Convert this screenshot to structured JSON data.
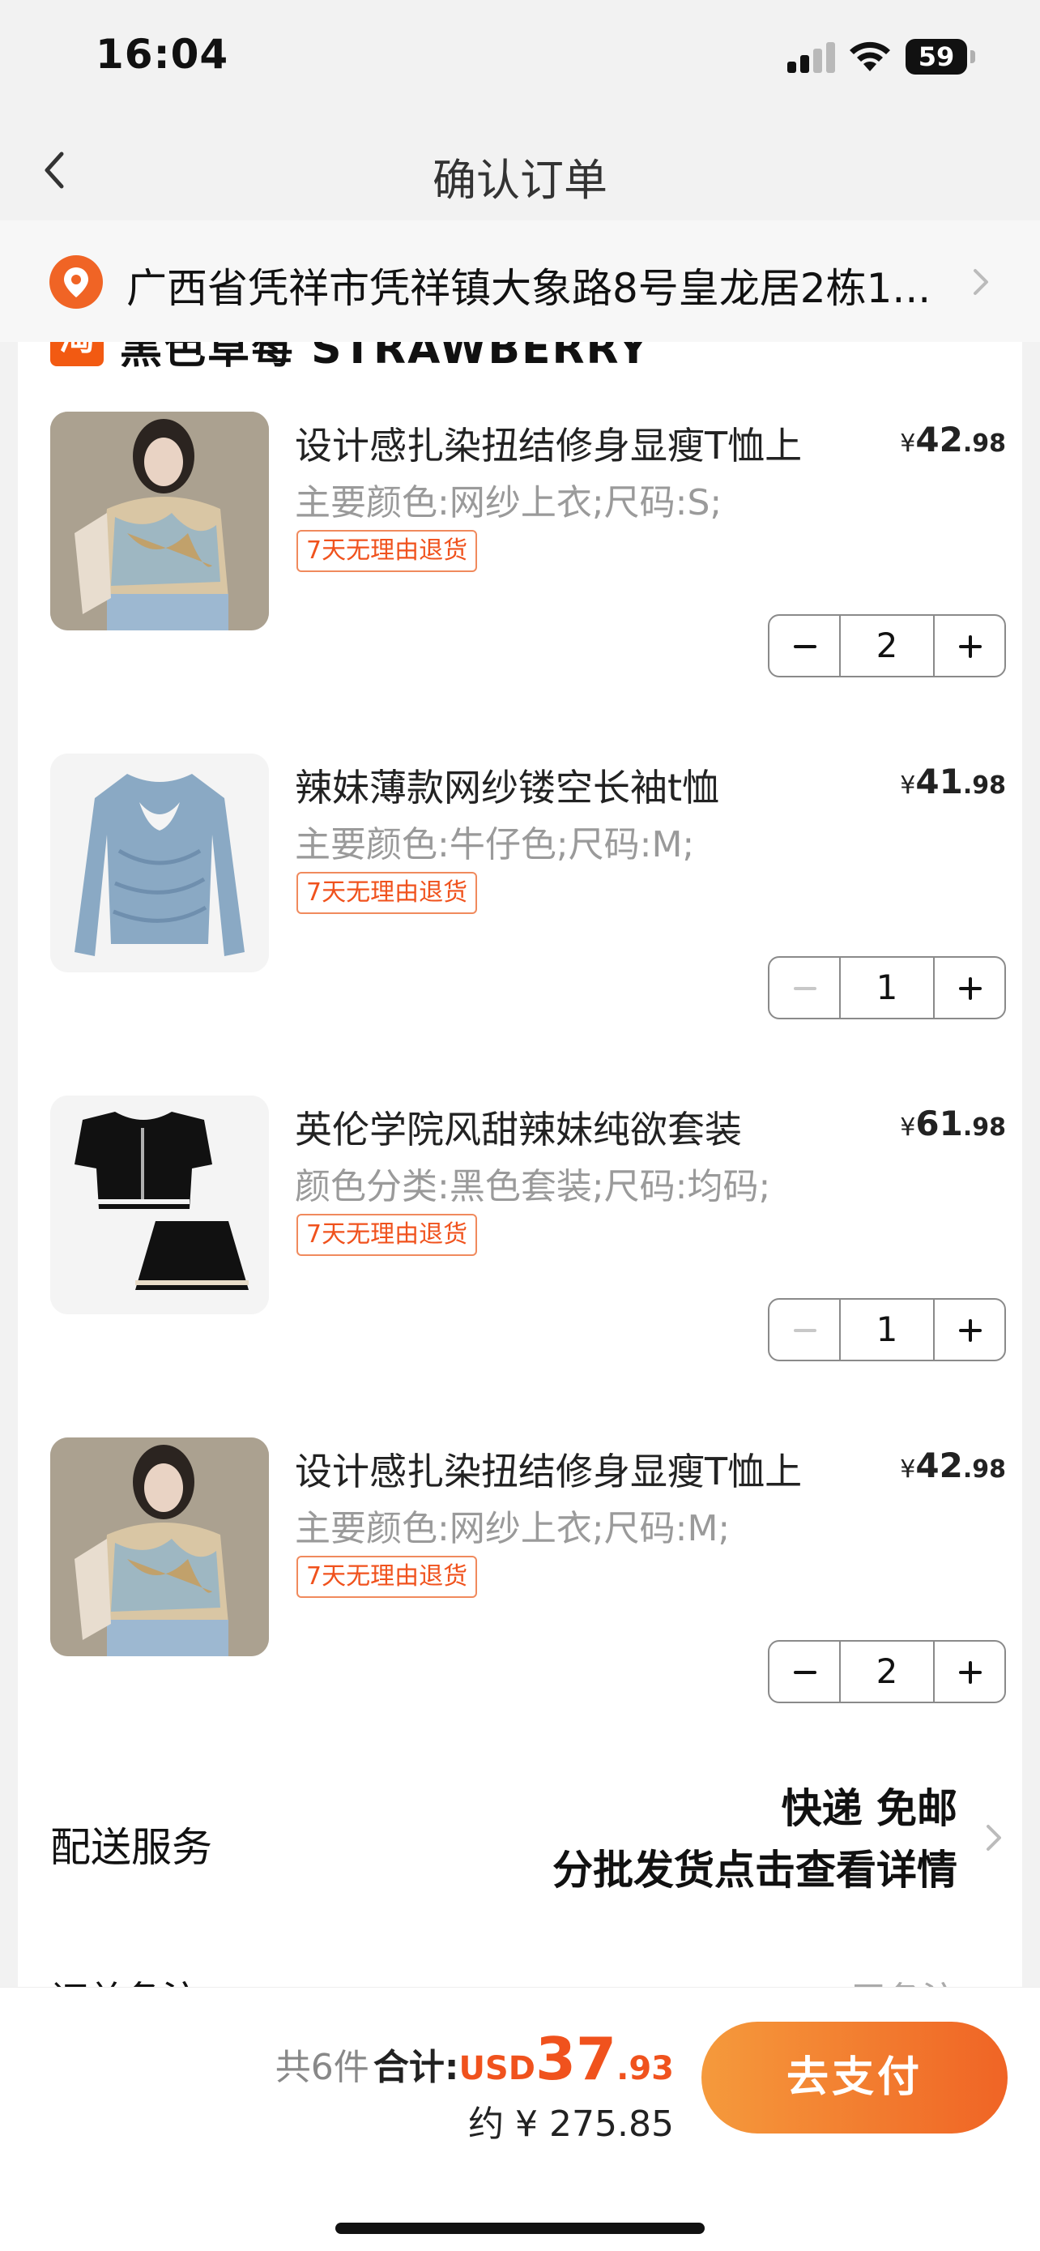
{
  "status_bar": {
    "time": "16:04",
    "battery": "59"
  },
  "nav": {
    "title": "确认订单"
  },
  "address": {
    "text": "广西省凭祥市凭祥镇大象路8号皇龙居2栋1..."
  },
  "shop": {
    "logo": "淘",
    "name": "黑色草莓 STRAWBERRY"
  },
  "products": [
    {
      "title": "设计感扎染扭结修身显瘦T恤上",
      "spec": "主要颜色:网纱上衣;尺码:S;",
      "badge": "7天无理由退货",
      "price_currency": "¥",
      "price_int": "42",
      "price_dec": ".98",
      "quantity": "2",
      "minus_enabled": true
    },
    {
      "title": "辣妹薄款网纱镂空长袖t恤",
      "spec": "主要颜色:牛仔色;尺码:M;",
      "badge": "7天无理由退货",
      "price_currency": "¥",
      "price_int": "41",
      "price_dec": ".98",
      "quantity": "1",
      "minus_enabled": false
    },
    {
      "title": "英伦学院风甜辣妹纯欲套装",
      "spec": "颜色分类:黑色套装;尺码:均码;",
      "badge": "7天无理由退货",
      "price_currency": "¥",
      "price_int": "61",
      "price_dec": ".98",
      "quantity": "1",
      "minus_enabled": false
    },
    {
      "title": "设计感扎染扭结修身显瘦T恤上",
      "spec": "主要颜色:网纱上衣;尺码:M;",
      "badge": "7天无理由退货",
      "price_currency": "¥",
      "price_int": "42",
      "price_dec": ".98",
      "quantity": "2",
      "minus_enabled": true
    }
  ],
  "shipping": {
    "label": "配送服务",
    "line1": "快递 免邮",
    "line2": "分批发货点击查看详情"
  },
  "remark": {
    "label": "订单备注",
    "value": "无备注"
  },
  "summary": {
    "count_label": "共6件",
    "total_label": "合计:",
    "currency": "USD",
    "total_int": "37",
    "total_dec": ".93",
    "approx": "约 ¥ 275.85",
    "pay_label": "去支付"
  },
  "colors": {
    "accent": "#f0521d",
    "pay_gradient_start": "#f59a3c",
    "pay_gradient_end": "#f06425"
  },
  "icons": {
    "back": "chevron-left-icon",
    "location": "location-pin-icon",
    "chevron": "chevron-right-icon"
  }
}
